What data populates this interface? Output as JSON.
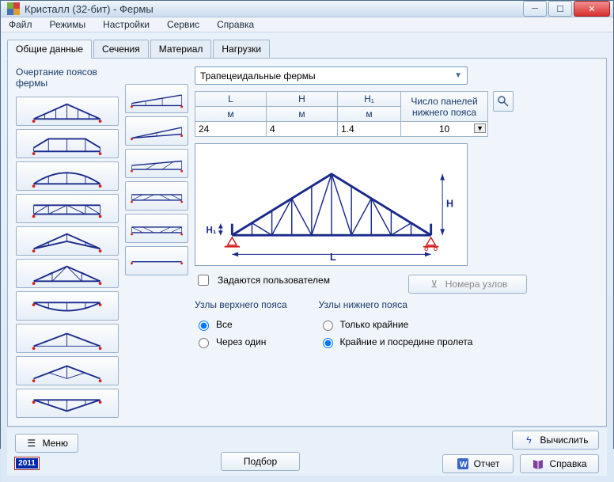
{
  "window": {
    "title": "Кристалл (32-бит) - Фермы"
  },
  "menu": {
    "file": "Файл",
    "modes": "Режимы",
    "settings": "Настройки",
    "service": "Сервис",
    "help": "Справка"
  },
  "tabs": {
    "general": "Общие данные",
    "sections": "Сечения",
    "material": "Материал",
    "loads": "Нагрузки"
  },
  "labels": {
    "outline": "Очертание поясов фермы",
    "combo_value": "Трапецеидальные фермы",
    "user_defined": "Задаются пользователем",
    "nodes_button": "Номера узлов",
    "top_chord": "Узлы верхнего пояса",
    "bottom_chord": "Узлы нижнего пояса",
    "r_all": "Все",
    "r_every_other": "Через один",
    "r_edge_only": "Только крайние",
    "r_edge_mid": "Крайние и посредине пролета"
  },
  "params": {
    "cols": {
      "L": "L",
      "H": "H",
      "H1": "H₁",
      "panels": "Число панелей нижнего пояса"
    },
    "units": {
      "m": "м"
    },
    "values": {
      "L": "24",
      "H": "4",
      "H1": "1.4",
      "panels": "10"
    }
  },
  "diagram": {
    "L": "L",
    "H": "H",
    "H1": "H₁"
  },
  "bottom": {
    "menu": "Меню",
    "podbor": "Подбор",
    "calc": "Вычислить",
    "report": "Отчет",
    "help": "Справка",
    "year": "2011"
  }
}
